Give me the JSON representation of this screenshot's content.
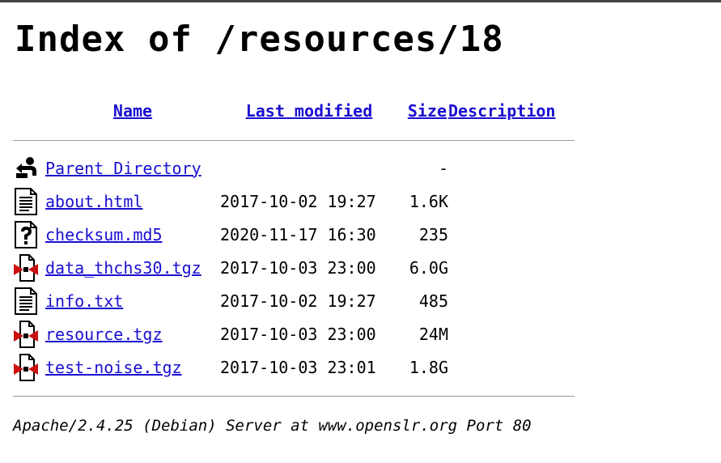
{
  "title": "Index of /resources/18",
  "columns": {
    "name": "Name",
    "last_modified": "Last modified",
    "size": "Size",
    "description": "Description"
  },
  "rows": [
    {
      "name": "Parent Directory",
      "modified": "",
      "size": "-",
      "description": "",
      "icon": "back-icon"
    },
    {
      "name": "about.html",
      "modified": "2017-10-02 19:27",
      "size": "1.6K",
      "description": "",
      "icon": "text-file-icon"
    },
    {
      "name": "checksum.md5",
      "modified": "2020-11-17 16:30",
      "size": "235",
      "description": "",
      "icon": "unknown-file-icon"
    },
    {
      "name": "data_thchs30.tgz",
      "modified": "2017-10-03 23:00",
      "size": "6.0G",
      "description": "",
      "icon": "archive-icon"
    },
    {
      "name": "info.txt",
      "modified": "2017-10-02 19:27",
      "size": "485",
      "description": "",
      "icon": "text-file-icon"
    },
    {
      "name": "resource.tgz",
      "modified": "2017-10-03 23:00",
      "size": "24M",
      "description": "",
      "icon": "archive-icon"
    },
    {
      "name": "test-noise.tgz",
      "modified": "2017-10-03 23:01",
      "size": "1.8G",
      "description": "",
      "icon": "archive-icon"
    }
  ],
  "footer": "Apache/2.4.25 (Debian) Server at www.openslr.org Port 80",
  "colors": {
    "link": "#1a0fd0",
    "rule": "#9a9a9a"
  }
}
